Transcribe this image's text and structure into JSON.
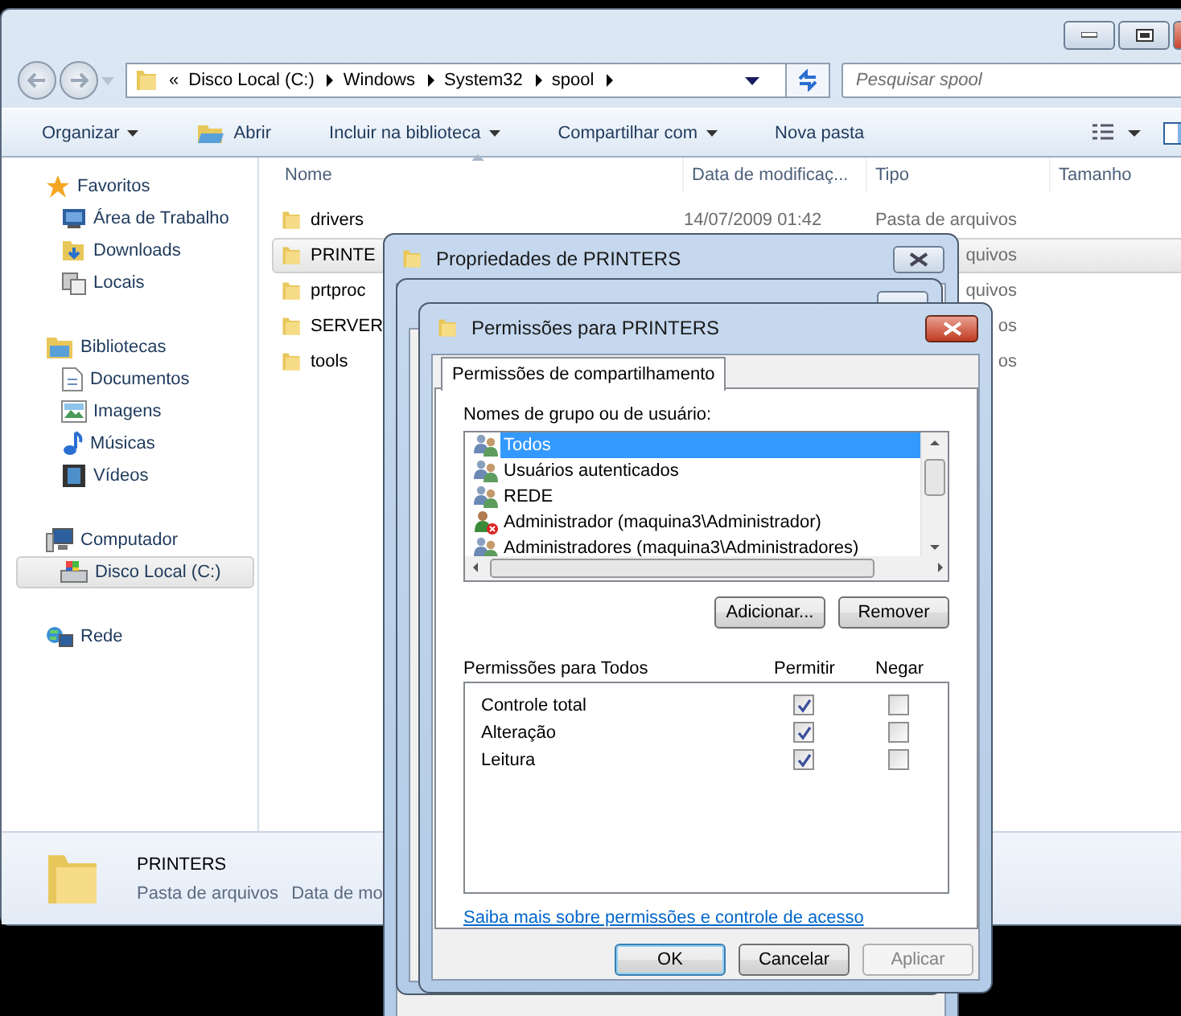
{
  "explorer": {
    "address": {
      "overflow": "«",
      "crumbs": [
        "Disco Local (C:)",
        "Windows",
        "System32",
        "spool"
      ]
    },
    "search": {
      "placeholder": "Pesquisar spool"
    },
    "toolbar": [
      {
        "label": "Organizar",
        "kind": "menu"
      },
      {
        "label": "Abrir",
        "kind": "icon"
      },
      {
        "label": "Incluir na biblioteca",
        "kind": "menu"
      },
      {
        "label": "Compartilhar com",
        "kind": "menu"
      },
      {
        "label": "Nova pasta",
        "kind": "plain"
      }
    ],
    "sidebar": [
      {
        "label": "Favoritos",
        "selected": false,
        "children": [
          {
            "label": "Área de Trabalho",
            "selected": false
          },
          {
            "label": "Downloads",
            "selected": false
          },
          {
            "label": "Locais",
            "selected": false
          }
        ]
      },
      {
        "label": "Bibliotecas",
        "selected": false,
        "children": [
          {
            "label": "Documentos",
            "selected": false
          },
          {
            "label": "Imagens",
            "selected": false
          },
          {
            "label": "Músicas",
            "selected": false
          },
          {
            "label": "Vídeos",
            "selected": false
          }
        ]
      },
      {
        "label": "Computador",
        "selected": false,
        "children": [
          {
            "label": "Disco Local (C:)",
            "selected": true
          }
        ]
      },
      {
        "label": "Rede",
        "selected": false
      }
    ],
    "columns": [
      {
        "label": "Nome",
        "sorted": true
      },
      {
        "label": "Data de modificaç...",
        "sorted": false
      },
      {
        "label": "Tipo",
        "sorted": false
      },
      {
        "label": "Tamanho",
        "sorted": false
      }
    ],
    "files": [
      {
        "name": "drivers",
        "date": "14/07/2009 01:42",
        "type": "Pasta de arquivos",
        "selected": false
      },
      {
        "name": "PRINTE",
        "type": "quivos",
        "selected": true
      },
      {
        "name": "prtproc",
        "type": "quivos",
        "selected": false
      },
      {
        "name": "SERVER",
        "type": "os",
        "selected": false
      },
      {
        "name": "tools",
        "type": "os",
        "selected": false
      }
    ],
    "details": {
      "name": "PRINTERS",
      "type": "Pasta de arquivos",
      "date_label": "Data de mo"
    }
  },
  "properties_dialog": {
    "title": "Propriedades de PRINTERS"
  },
  "permissions_dialog": {
    "title": "Permissões para PRINTERS",
    "tabs": [
      {
        "label": "Permissões de compartilhamento",
        "selected": true
      }
    ],
    "users_label": "Nomes de grupo ou de usuário:",
    "users": [
      {
        "name": "Todos",
        "selected": true,
        "disabled": false
      },
      {
        "name": "Usuários autenticados",
        "selected": false,
        "disabled": false
      },
      {
        "name": "REDE",
        "selected": false,
        "disabled": false
      },
      {
        "name": "Administrador (maquina3\\Administrador)",
        "selected": false,
        "disabled": true
      },
      {
        "name": "Administradores (maquina3\\Administradores)",
        "selected": false,
        "disabled": false
      }
    ],
    "list_buttons": [
      "Adicionar...",
      "Remover"
    ],
    "permissions_label": "Permissões para Todos",
    "permission_columns": [
      "Permitir",
      "Negar"
    ],
    "permissions": [
      {
        "name": "Controle total",
        "allow": true,
        "deny": false
      },
      {
        "name": "Alteração",
        "allow": true,
        "deny": false
      },
      {
        "name": "Leitura",
        "allow": true,
        "deny": false
      }
    ],
    "link": "Saiba mais sobre permissões e controle de acesso",
    "buttons": [
      {
        "label": "OK",
        "default": true,
        "disabled": false
      },
      {
        "label": "Cancelar",
        "default": false,
        "disabled": false
      },
      {
        "label": "Aplicar",
        "default": false,
        "disabled": true
      }
    ]
  }
}
